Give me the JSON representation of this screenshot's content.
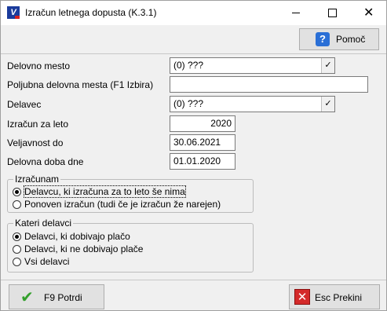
{
  "window": {
    "title": "Izračun letnega dopusta  (K.3.1)",
    "icon_name": "app-logo-icon"
  },
  "toolbar": {
    "help_label": "Pomoč",
    "help_icon": "help-book-icon"
  },
  "form": {
    "delovno_mesto": {
      "label": "Delovno mesto",
      "value": "(0) ???"
    },
    "poljubna_delovna_mesta": {
      "label": "Poljubna delovna mesta (F1 Izbira)",
      "value": ""
    },
    "delavec": {
      "label": "Delavec",
      "value": "(0) ???"
    },
    "izracun_za_leto": {
      "label": "Izračun za leto",
      "value": "2020"
    },
    "veljavnost_do": {
      "label": "Veljavnost do",
      "value": "30.06.2021"
    },
    "delovna_doba_dne": {
      "label": "Delovna doba dne",
      "value": "01.01.2020"
    }
  },
  "izracunam": {
    "title": "Izračunam",
    "options": [
      {
        "label": "Delavcu, ki izračuna za to leto še nima",
        "selected": true
      },
      {
        "label": "Ponoven izračun (tudi če je izračun že narejen)",
        "selected": false
      }
    ]
  },
  "kateri_delavci": {
    "title": "Kateri delavci",
    "options": [
      {
        "label": "Delavci, ki dobivajo plačo",
        "selected": true
      },
      {
        "label": "Delavci, ki ne dobivajo plače",
        "selected": false
      },
      {
        "label": "Vsi delavci",
        "selected": false
      }
    ]
  },
  "actions": {
    "confirm_label": "F9 Potrdi",
    "cancel_label": "Esc Prekini"
  },
  "colors": {
    "window_bg": "#f0f0f0",
    "titlebar_bg": "#ffffff",
    "button_bg": "#e1e1e1",
    "confirm_icon": "#33a02c",
    "cancel_icon": "#d42a2a",
    "help_icon": "#2a6fd6"
  }
}
